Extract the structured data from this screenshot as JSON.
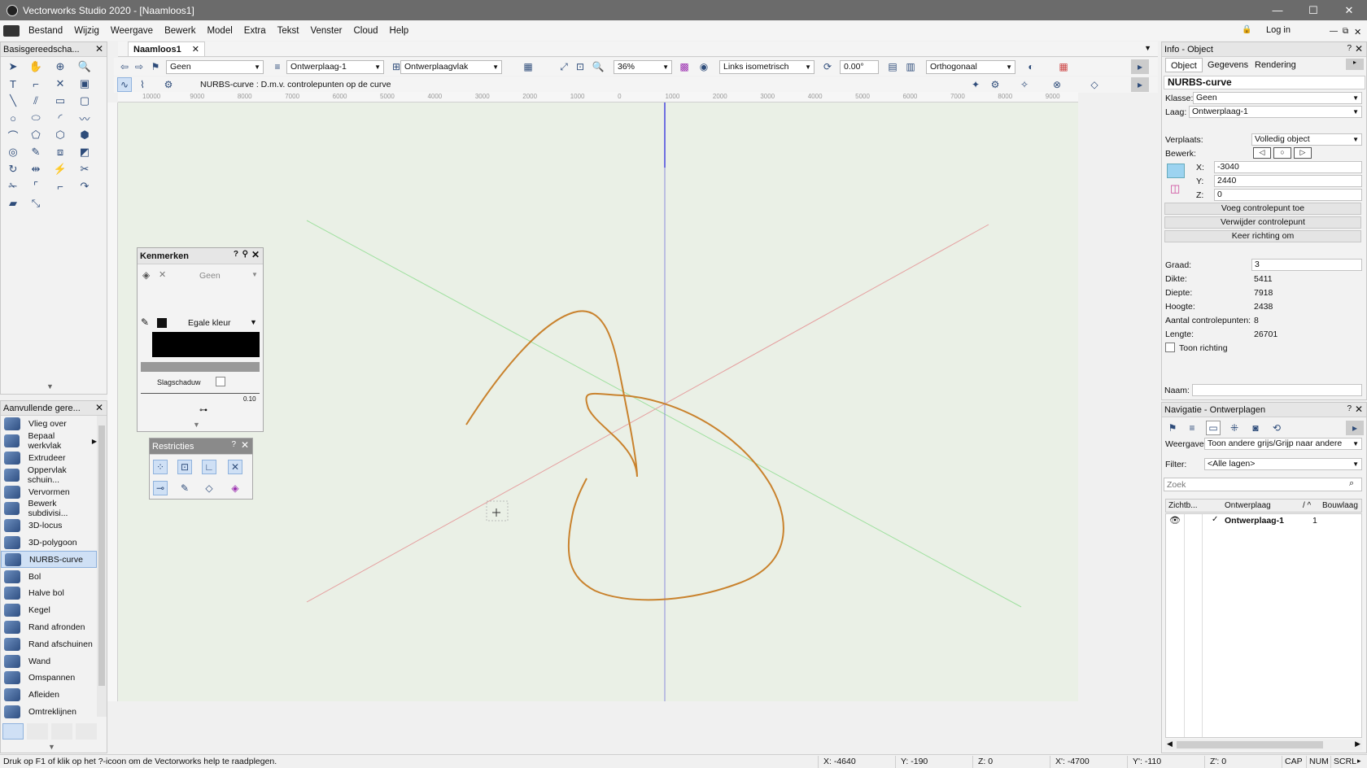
{
  "window": {
    "title": "Vectorworks Studio 2020 - [Naamloos1]",
    "minimize": "—",
    "maximize": "☐",
    "close": "✕"
  },
  "menu": [
    "Bestand",
    "Wijzig",
    "Weergave",
    "Bewerk",
    "Model",
    "Extra",
    "Tekst",
    "Venster",
    "Cloud",
    "Help"
  ],
  "account": {
    "login": "Log in"
  },
  "basis_palette": {
    "title": "Basisgereedscha..."
  },
  "aanvullend_palette": {
    "title": "Aanvullende gere...",
    "items": [
      "Vlieg over",
      "Bepaal werkvlak",
      "Extrudeer",
      "Oppervlak schuin...",
      "Vervormen",
      "Bewerk subdivisi...",
      "3D-locus",
      "3D-polygoon",
      "NURBS-curve",
      "Bol",
      "Halve bol",
      "Kegel",
      "Rand afronden",
      "Rand afschuinen",
      "Wand",
      "Omspannen",
      "Afleiden",
      "Omtreklijnen"
    ],
    "selected": "NURBS-curve"
  },
  "document_tab": "Naamloos1",
  "view_bar": {
    "class_value": "Geen",
    "layer_value": "Ontwerplaag-1",
    "plane_value": "Ontwerplaagvlak",
    "zoom": "36%",
    "view": "Links isometrisch",
    "angle": "0.00°",
    "projection": "Orthogonaal"
  },
  "mode_bar": {
    "hint": "NURBS-curve : D.m.v. controlepunten op de curve"
  },
  "ruler_labels": [
    "10000",
    "9000",
    "8000",
    "7000",
    "6000",
    "5000",
    "4000",
    "3000",
    "2000",
    "1000",
    "0",
    "1000",
    "2000",
    "3000",
    "4000",
    "5000",
    "6000",
    "7000",
    "8000",
    "9000"
  ],
  "kenmerken": {
    "title": "Kenmerken",
    "fill_value": "Geen",
    "pen_value": "Egale kleur",
    "shadow_label": "Slagschaduw",
    "thickness": "0.10"
  },
  "restricties": {
    "title": "Restricties"
  },
  "info_panel": {
    "title": "Info - Object",
    "tabs": [
      "Object",
      "Gegevens",
      "Rendering"
    ],
    "object_type": "NURBS-curve",
    "klasse_label": "Klasse:",
    "klasse_value": "Geen",
    "laag_label": "Laag:",
    "laag_value": "Ontwerplaag-1",
    "verplaats_label": "Verplaats:",
    "verplaats_value": "Volledig object",
    "bewerk_label": "Bewerk:",
    "x_label": "X:",
    "x_value": "-3040",
    "y_label": "Y:",
    "y_value": "2440",
    "z_label": "Z:",
    "z_value": "0",
    "btn_add": "Voeg controlepunt toe",
    "btn_remove": "Verwijder controlepunt",
    "btn_reverse": "Keer richting om",
    "props": [
      {
        "label": "Graad:",
        "value": "3"
      },
      {
        "label": "Dikte:",
        "value": "5411"
      },
      {
        "label": "Diepte:",
        "value": "7918"
      },
      {
        "label": "Hoogte:",
        "value": "2438"
      },
      {
        "label": "Aantal controlepunten:",
        "value": "8"
      },
      {
        "label": "Lengte:",
        "value": "26701"
      }
    ],
    "toon_richting": "Toon richting",
    "naam_label": "Naam:"
  },
  "nav_panel": {
    "title": "Navigatie - Ontwerplagen",
    "weergave_label": "Weergave:",
    "weergave_value": "Toon andere grijs/Grijp naar andere",
    "filter_label": "Filter:",
    "filter_value": "<Alle lagen>",
    "search_placeholder": "Zoek",
    "col_vis": "Zichtb...",
    "col_layer": "Ontwerplaag",
    "col_sort": "/ ^",
    "col_build": "Bouwlaag",
    "row_layer": "Ontwerplaag-1",
    "row_num": "1"
  },
  "status": {
    "hint": "Druk op F1 of klik op het ?-icoon om de Vectorworks help te raadplegen.",
    "x1": "X: -4640",
    "y1": "Y: -190",
    "z1": "Z: 0",
    "x2": "X': -4700",
    "y2": "Y': -110",
    "z2": "Z': 0",
    "cap": "CAP",
    "num": "NUM",
    "scrl": "SCRL"
  },
  "colors": {
    "curve": "#c9822d",
    "axis_x": "#e5a0a0",
    "axis_y": "#9fe09f",
    "axis_z": "#8c8cdc",
    "canvas_bg": "#eaf0e6"
  }
}
